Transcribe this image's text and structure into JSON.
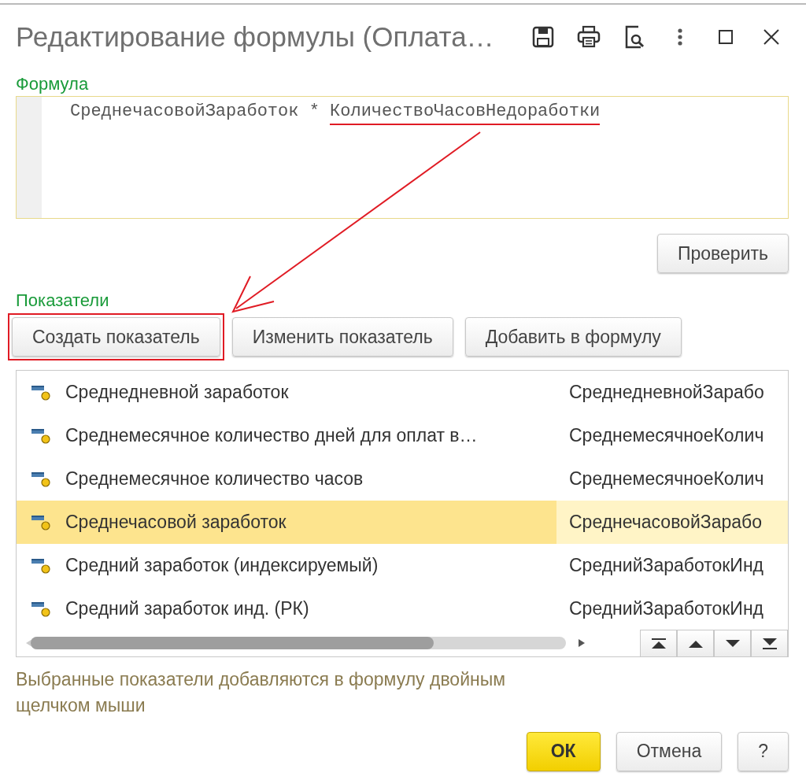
{
  "window": {
    "title": "Редактирование формулы (Оплата…"
  },
  "formula": {
    "label": "Формула",
    "parts": [
      {
        "text": "СреднечасовойЗаработок * ",
        "underlined": false
      },
      {
        "text": "КоличествоЧасовНедоработки",
        "underlined": true
      }
    ]
  },
  "check_button": "Проверить",
  "indicators": {
    "label": "Показатели",
    "buttons": [
      {
        "label": "Создать показатель",
        "highlighted": true
      },
      {
        "label": "Изменить показатель",
        "highlighted": false
      },
      {
        "label": "Добавить в формулу",
        "highlighted": false
      }
    ],
    "rows": [
      {
        "name": "Среднедневной заработок",
        "code": "СреднедневнойЗарабо",
        "selected": false
      },
      {
        "name": "Среднемесячное количество дней для оплат в…",
        "code": "СреднемесячноеКолич",
        "selected": false
      },
      {
        "name": "Среднемесячное количество часов",
        "code": "СреднемесячноеКолич",
        "selected": false
      },
      {
        "name": "Среднечасовой заработок",
        "code": "СреднечасовойЗарабо",
        "selected": true
      },
      {
        "name": "Средний заработок (индексируемый)",
        "code": "СреднийЗаработокИнд",
        "selected": false
      },
      {
        "name": "Средний заработок инд. (РК)",
        "code": "СреднийЗаработокИнд",
        "selected": false
      }
    ]
  },
  "hint": "Выбранные показатели добавляются в формулу двойным щелчком мыши",
  "footer_buttons": [
    {
      "label": "ОК",
      "kind": "primary"
    },
    {
      "label": "Отмена",
      "kind": "normal"
    },
    {
      "label": "?",
      "kind": "normal"
    }
  ]
}
